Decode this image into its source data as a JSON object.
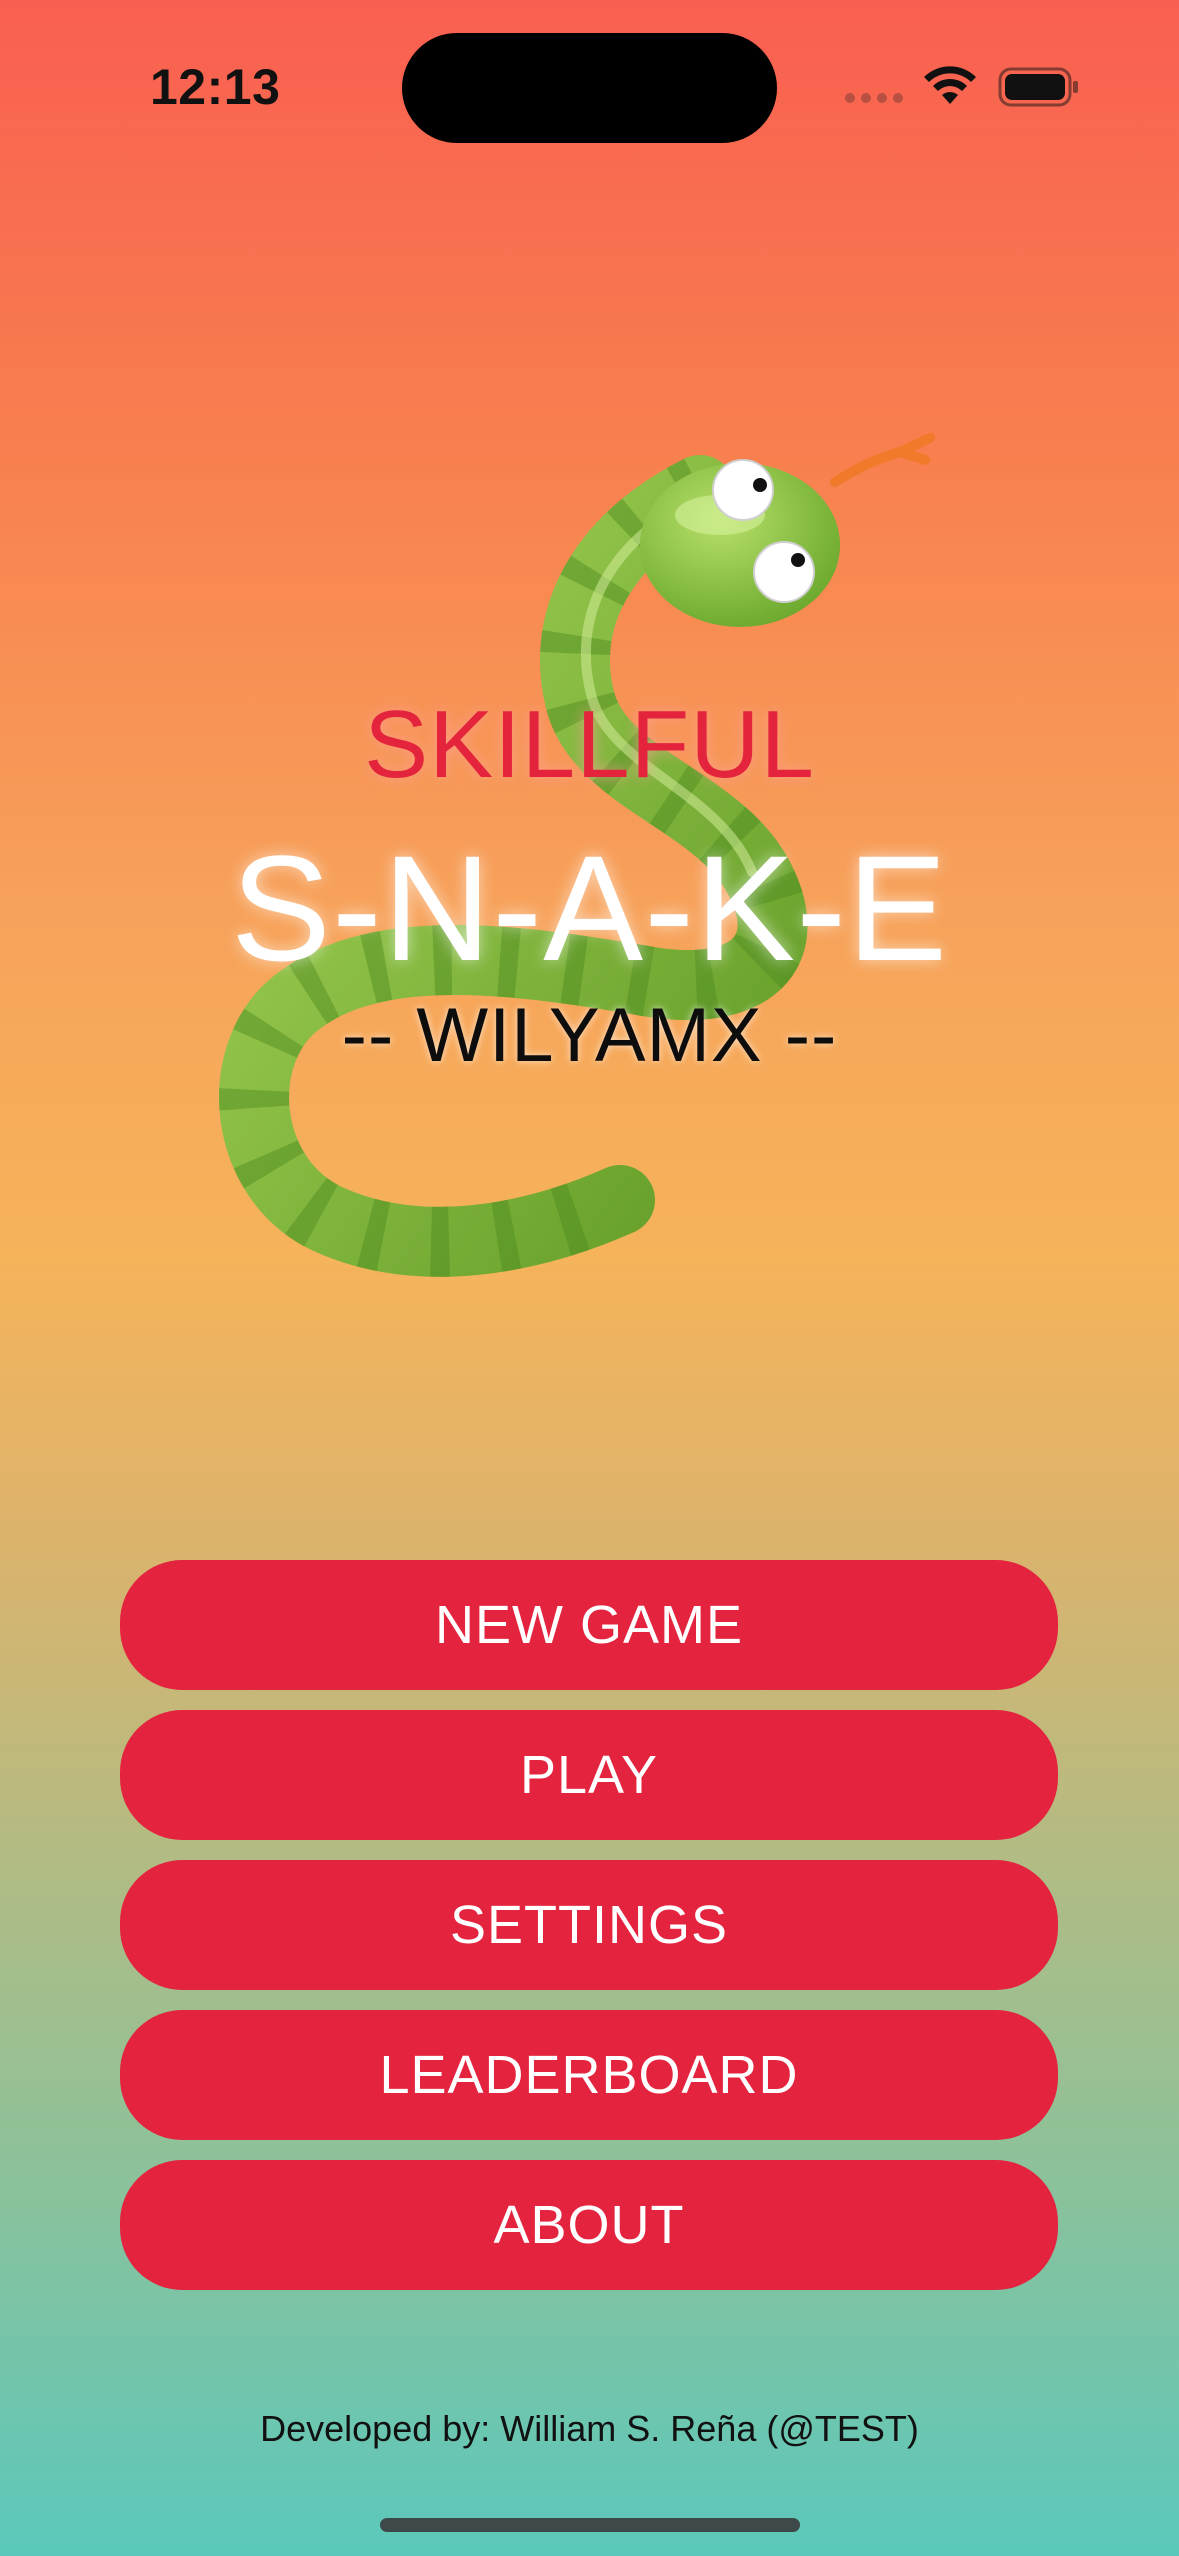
{
  "status_bar": {
    "time": "12:13",
    "icons": [
      "signal-icon",
      "wifi-icon",
      "battery-icon"
    ]
  },
  "title": {
    "line1": "SKILLFUL",
    "line2": "S-N-A-K-E",
    "line3": "-- WILYAMX --"
  },
  "menu": {
    "new_game": "NEW GAME",
    "play": "PLAY",
    "settings": "SETTINGS",
    "leaderboard": "LEADERBOARD",
    "about": "ABOUT"
  },
  "footer": {
    "credit": "Developed by: William S. Reña (@TEST)"
  },
  "colors": {
    "gradient_top": "#f95f50",
    "gradient_bottom": "#5bc8bb",
    "button": "#e4233f",
    "skillful_text": "#e4233d"
  }
}
